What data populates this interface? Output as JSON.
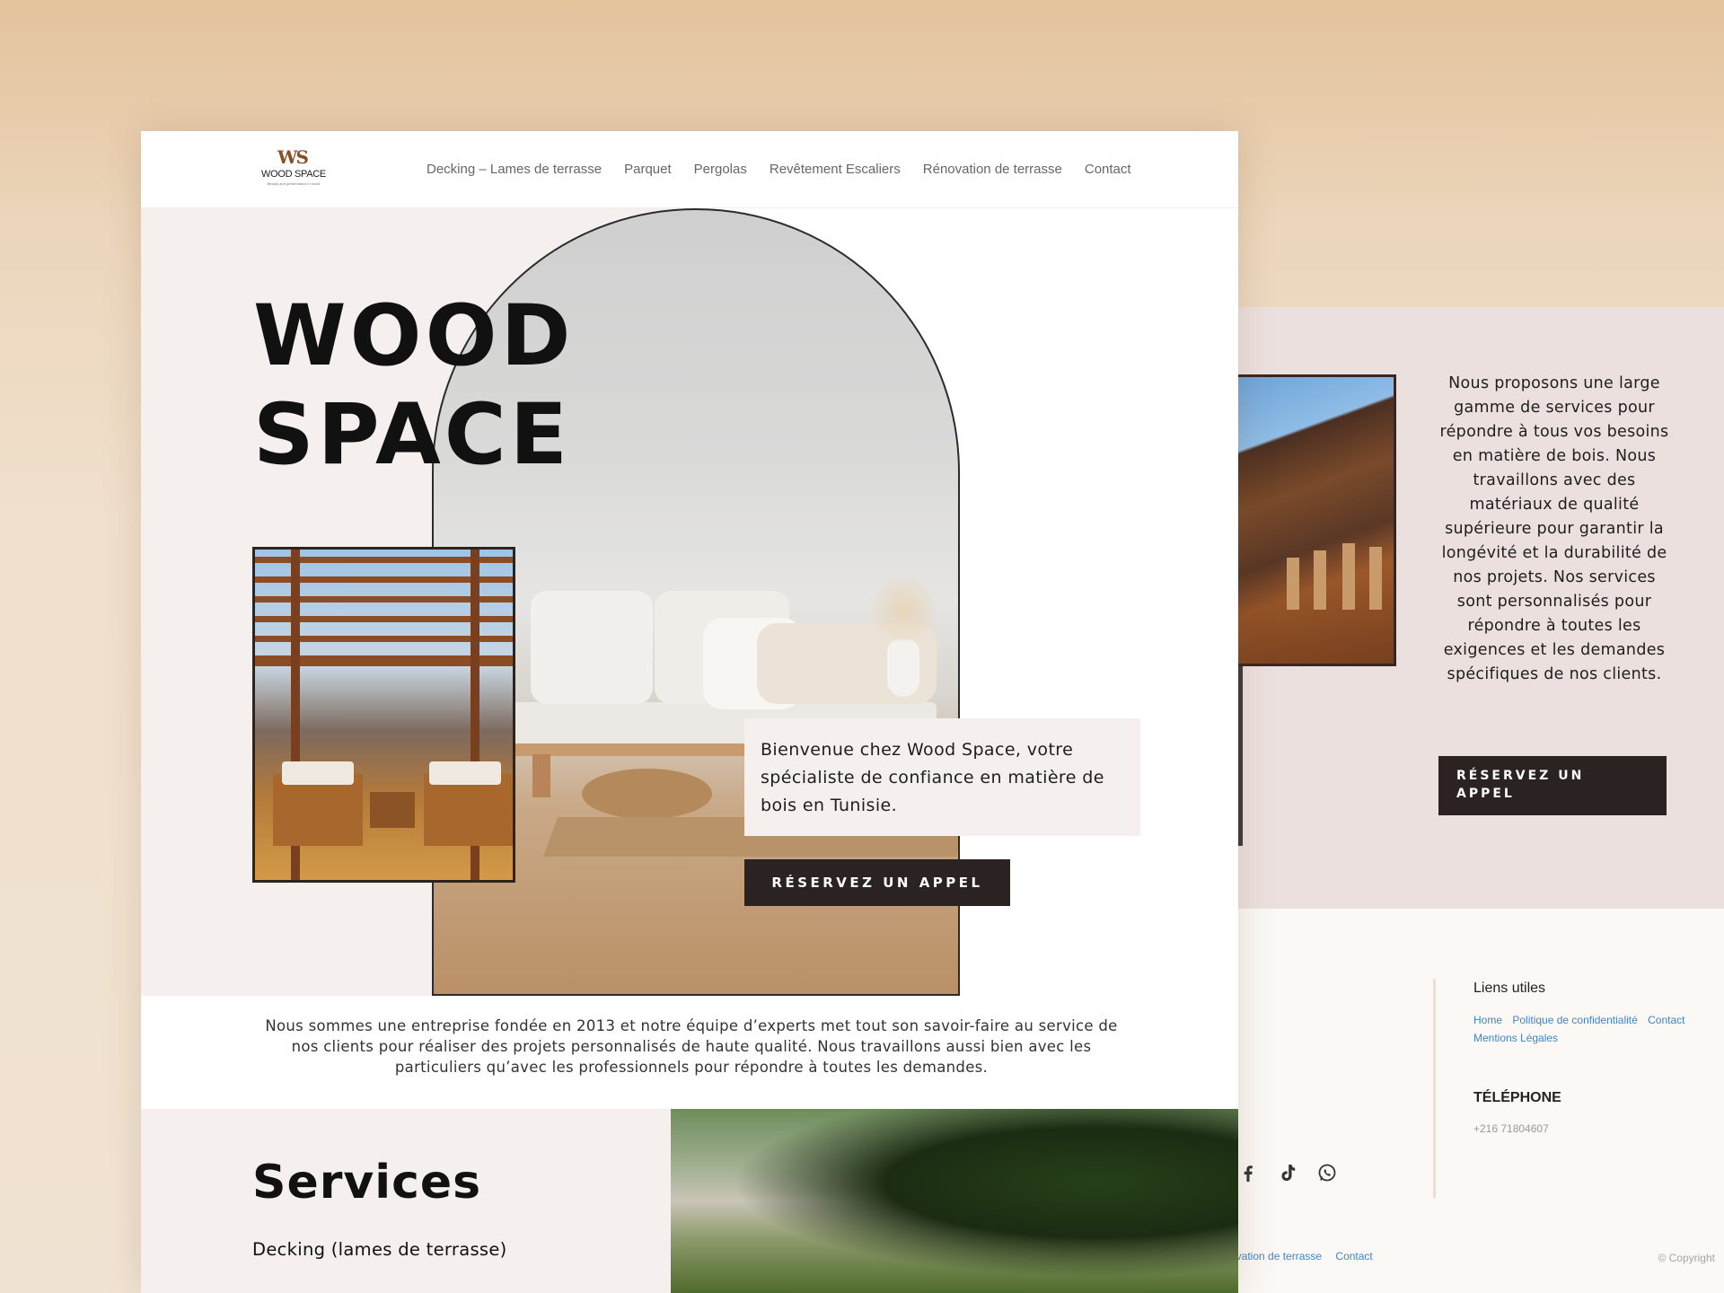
{
  "brand": {
    "name": "WOOD SPACE",
    "logo_mark": "WS",
    "tagline": "Beauty and performance in wood"
  },
  "nav": {
    "items": [
      "Decking – Lames de terrasse",
      "Parquet",
      "Pergolas",
      "Revêtement Escaliers",
      "Rénovation de terrasse",
      "Contact"
    ]
  },
  "hero": {
    "title_line1": "WOOD",
    "title_line2": "SPACE",
    "welcome": "Bienvenue chez Wood Space, votre spécialiste de confiance en matière de bois en Tunisie.",
    "cta": "RÉSERVEZ UN APPEL"
  },
  "about": {
    "text": "Nous sommes une entreprise fondée en 2013 et notre équipe d’experts met tout son savoir-faire au service de nos clients pour réaliser des projets personnalisés de haute qualité. Nous travaillons aussi bien avec les particuliers qu’avec les professionnels pour répondre à toutes les demandes."
  },
  "services": {
    "title": "Services",
    "first_item": "Decking (lames de terrasse)"
  },
  "back_page": {
    "intro": "Nous proposons une large gamme de services pour répondre à tous vos besoins en matière de bois. Nous travaillons avec des matériaux de qualité supérieure pour garantir la longévité et la durabilité de nos projets. Nos services sont personnalisés pour répondre à toutes les exigences et les demandes spécifiques de nos clients.",
    "cta": "RÉSERVEZ UN APPEL",
    "links_heading": "Liens utiles",
    "links": [
      "Home",
      "Politique de confidentialité",
      "Contact",
      "Mentions Légales"
    ],
    "phone_heading": "TÉLÉPHONE",
    "phone": "+216 71804607",
    "social_icons": [
      "facebook-icon",
      "tiktok-icon",
      "whatsapp-icon"
    ],
    "bottom_links": [
      "ovation de terrasse",
      "Contact"
    ],
    "copyright": "© Copyright"
  },
  "colors": {
    "dark": "#2a2321",
    "accent_brown": "#8b4f24",
    "link_blue": "#3f86c6",
    "beige_bg": "#f5f0ed",
    "pink_bg": "#ece0df"
  }
}
